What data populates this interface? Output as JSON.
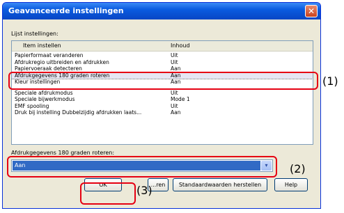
{
  "dialog": {
    "title": "Geavanceerde instellingen",
    "close_glyph": "✕"
  },
  "list_label": "Lijst instellingen:",
  "list": {
    "columns": [
      "Item instellen",
      "Inhoud"
    ],
    "rows": [
      {
        "item": "Papierformaat veranderen",
        "value": "Uit"
      },
      {
        "item": "Afdrukregio uitbreiden en afdrukken",
        "value": "Uit"
      },
      {
        "item": "Papiervoeraak detecteren",
        "value": "Aan"
      },
      {
        "item": "Afdrukgegevens 180 graden roteren",
        "value": "Aan",
        "selected": true
      },
      {
        "item": "Kleur instellingen",
        "value": "Aan"
      },
      {
        "item": "Speciale afdrukmodus",
        "value": "Uit"
      },
      {
        "item": "Speciale bijwerkmodus",
        "value": "Mode 1"
      },
      {
        "item": "EMF spooling",
        "value": "Uit"
      },
      {
        "item": "Druk bij instelling Dubbelzijdig afdrukken laats...",
        "value": "Aan"
      }
    ]
  },
  "setting_label": "Afdrukgegevens 180 graden roteren:",
  "combo": {
    "value": "Aan",
    "arrow": "▾"
  },
  "buttons": {
    "ok": "OK",
    "cancel": "...ren",
    "defaults": "Standaardwaarden herstellen",
    "help": "Help"
  },
  "callouts": [
    "(1)",
    "(2)",
    "(3)"
  ],
  "colors": {
    "title_bar": "#0a5be0",
    "callout": "#e60012",
    "selection": "#316ac5"
  }
}
